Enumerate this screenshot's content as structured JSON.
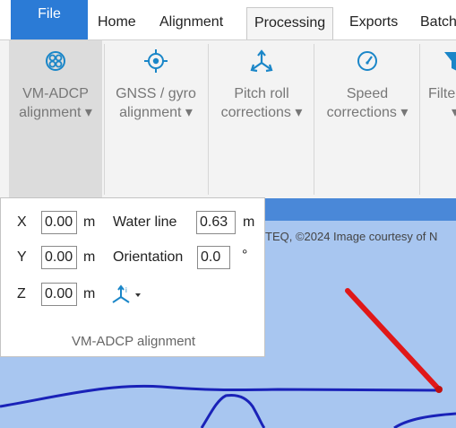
{
  "tabs": [
    {
      "label": "File"
    },
    {
      "label": "Home"
    },
    {
      "label": "Alignment"
    },
    {
      "label": "Processing"
    },
    {
      "label": "Exports"
    },
    {
      "label": "Batch"
    }
  ],
  "ribbon": {
    "vm_adcp": {
      "line1": "VM-ADCP",
      "line2": "alignment ▾"
    },
    "gnss_gyro": {
      "line1": "GNSS / gyro",
      "line2": "alignment ▾"
    },
    "pitch_roll": {
      "line1": "Pitch roll",
      "line2": "corrections ▾"
    },
    "speed": {
      "line1": "Speed",
      "line2": "corrections ▾"
    },
    "filter": {
      "line1": "Filters",
      "line2": "▾"
    }
  },
  "panel": {
    "x_label": "X",
    "x_value": "0.00",
    "x_unit": "m",
    "y_label": "Y",
    "y_value": "0.00",
    "y_unit": "m",
    "z_label": "Z",
    "z_value": "0.00",
    "z_unit": "m",
    "waterline_label": "Water line",
    "waterline_value": "0.63",
    "waterline_unit": "m",
    "orientation_label": "Orientation",
    "orientation_value": "0.0",
    "orientation_unit": "°",
    "footer": "VM-ADCP alignment"
  },
  "map": {
    "attribution": "TEQ, ©2024 Image courtesy of N"
  },
  "colors": {
    "file_tab": "#2b7bd6",
    "accent_icon": "#1a86c8",
    "map_water": "#a8c6f0",
    "map_header": "#4a88d8",
    "track_line": "#e01818",
    "shoreline": "#1a22b8"
  }
}
